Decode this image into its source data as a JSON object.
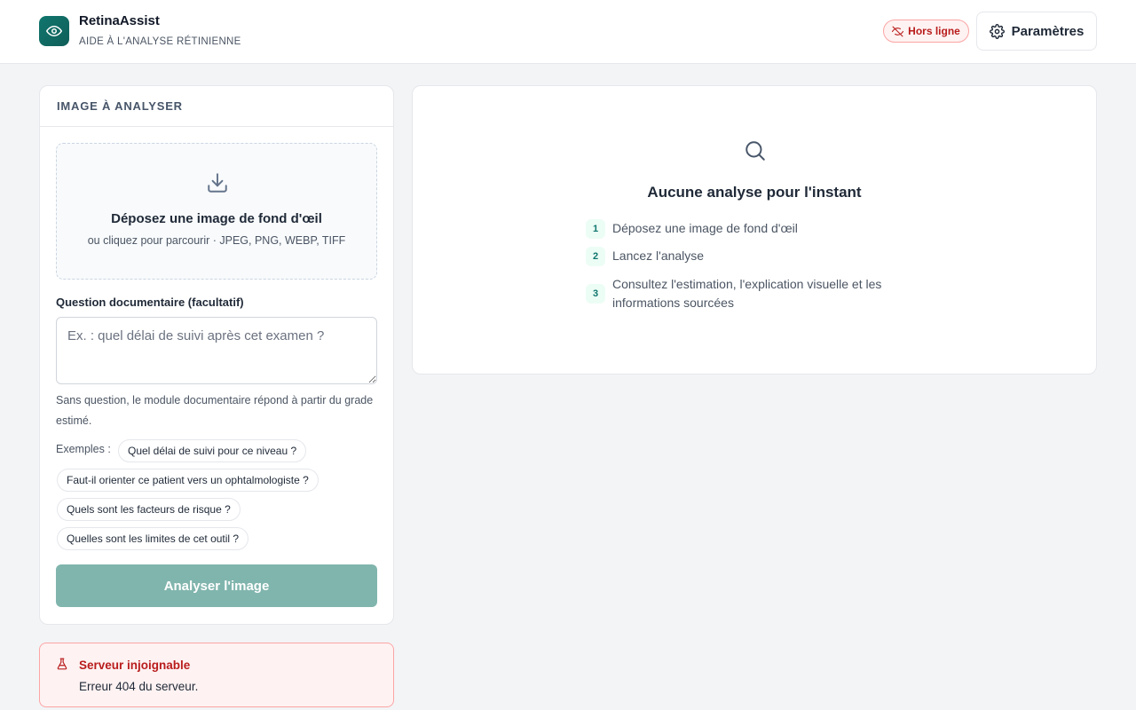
{
  "header": {
    "app_name": "RetinaAssist",
    "subtitle": "AIDE À L'ANALYSE RÉTINIENNE",
    "status_label": "Hors ligne",
    "settings_label": "Paramètres",
    "logo_icon": "eye-icon",
    "status_icon": "offline-cloud-icon",
    "settings_icon": "gear-icon"
  },
  "colors": {
    "brand": "#0f766e",
    "offline": "#b91c1c",
    "disabled_button": "#80b5ad"
  },
  "upload": {
    "section_title": "IMAGE À ANALYSER",
    "drop_title": "Déposez une image de fond d'œil",
    "drop_subtitle": "ou cliquez pour parcourir · JPEG, PNG, WEBP, TIFF",
    "drop_icon": "download-icon"
  },
  "question": {
    "label": "Question documentaire (facultatif)",
    "placeholder": "Ex. : quel délai de suivi après cet examen ?",
    "value": "",
    "hint": "Sans question, le module documentaire répond à partir du grade estimé.",
    "examples_label": "Exemples :",
    "examples": [
      "Quel délai de suivi pour ce niveau ?",
      "Faut-il orienter ce patient vers un ophtalmologiste ?",
      "Quels sont les facteurs de risque ?",
      "Quelles sont les limites de cet outil ?"
    ]
  },
  "analyze_button": "Analyser l'image",
  "error": {
    "title": "Serveur injoignable",
    "message": "Erreur 404 du serveur.",
    "icon": "flask-icon"
  },
  "results": {
    "empty_title": "Aucune analyse pour l'instant",
    "empty_icon": "search-icon",
    "steps": [
      {
        "num": "1",
        "text": "Déposez une image de fond d'œil"
      },
      {
        "num": "2",
        "text": "Lancez l'analyse"
      },
      {
        "num": "3",
        "text": "Consultez l'estimation, l'explication visuelle et les informations sourcées"
      }
    ]
  }
}
